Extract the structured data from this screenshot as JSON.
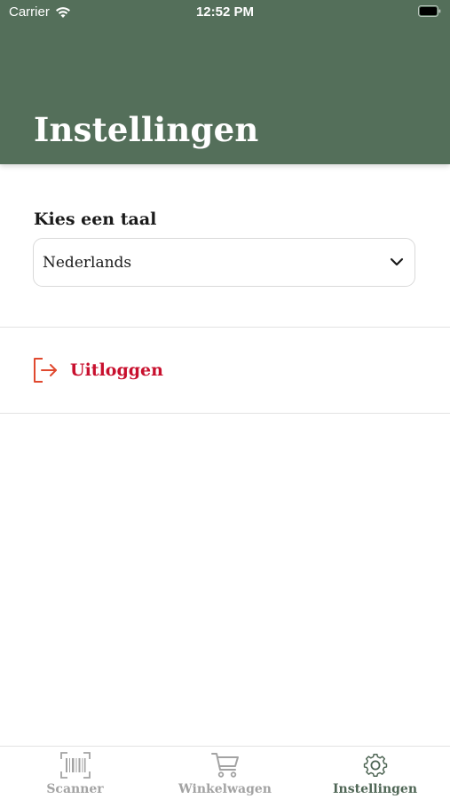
{
  "status_bar": {
    "carrier": "Carrier",
    "time": "12:52 PM"
  },
  "header": {
    "title": "Instellingen",
    "background_color": "#546f5a"
  },
  "language": {
    "label": "Kies een taal",
    "selected": "Nederlands"
  },
  "logout": {
    "label": "Uitloggen",
    "color": "#c8102e",
    "icon": "logout-icon"
  },
  "tab_bar": {
    "active_color": "#4f6655",
    "inactive_color": "#a3a3a3",
    "tabs": [
      {
        "label": "Scanner",
        "icon": "barcode-scanner-icon",
        "active": false
      },
      {
        "label": "Winkelwagen",
        "icon": "shopping-cart-icon",
        "active": false
      },
      {
        "label": "Instellingen",
        "icon": "gear-icon",
        "active": true
      }
    ]
  }
}
